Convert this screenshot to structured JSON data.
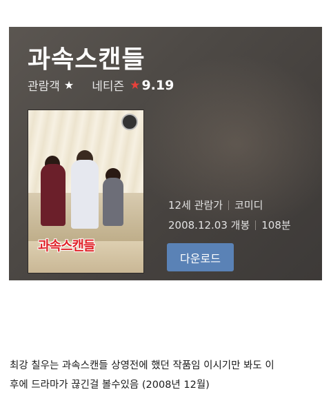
{
  "movie": {
    "title": "과속스캔들",
    "audience_label": "관람객",
    "audience_star": "★",
    "netizen_label": "네티즌",
    "netizen_star": "★",
    "netizen_score": "9.19",
    "age_rating": "12세 관람가",
    "genre": "코미디",
    "release_date": "2008.12.03 개봉",
    "runtime": "108분",
    "download_label": "다운로드"
  },
  "poster": {
    "title_text": "과속스캔들",
    "icon": "movie-poster-image"
  },
  "caption": {
    "line1": "최강 칠우는 과속스캔들 상영전에 했던 작품임 이시기만 봐도 이",
    "line2": "후에 드라마가 끊긴걸 볼수있음 (2008년 12월)"
  },
  "colors": {
    "card_bg": "#4e4a46",
    "accent_star": "#e8403a",
    "button_bg": "#5a82b6"
  }
}
